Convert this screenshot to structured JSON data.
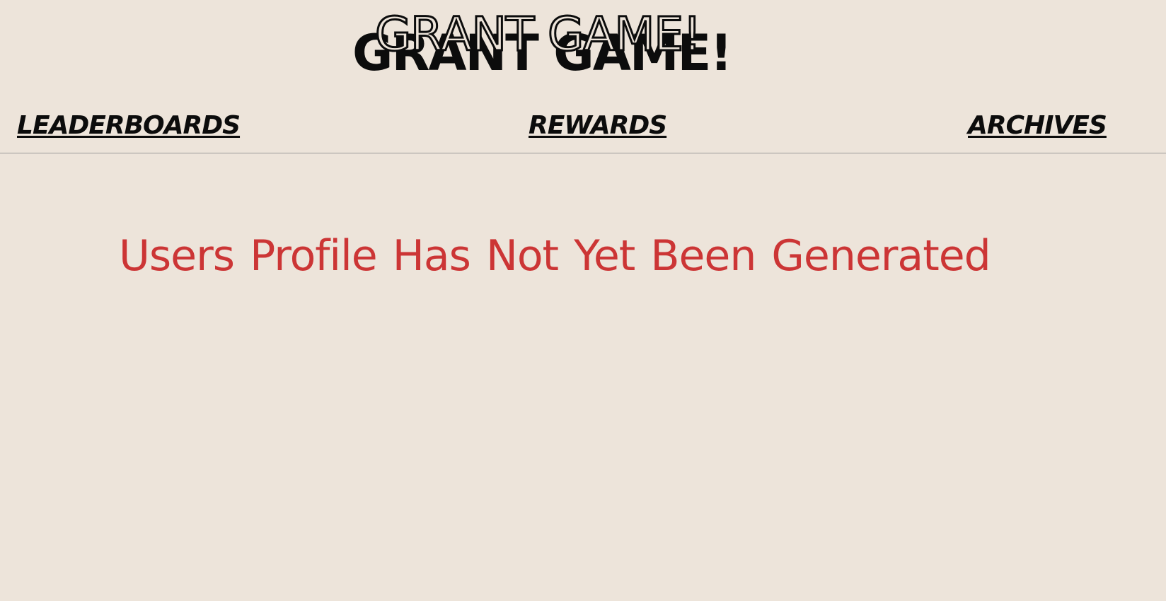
{
  "header": {
    "logo_text": "GRANT GAME!",
    "logo_outline_text": "GRANT GAME!"
  },
  "nav": {
    "items": [
      {
        "label": "LEADERBOARDS"
      },
      {
        "label": "REWARDS"
      },
      {
        "label": "ARCHIVES"
      }
    ]
  },
  "main": {
    "message": "Users Profile Has Not Yet Been Generated"
  },
  "colors": {
    "background": "#ede4da",
    "text": "#0c0c0c",
    "error": "#cc3535",
    "divider": "#9a9a9a"
  }
}
